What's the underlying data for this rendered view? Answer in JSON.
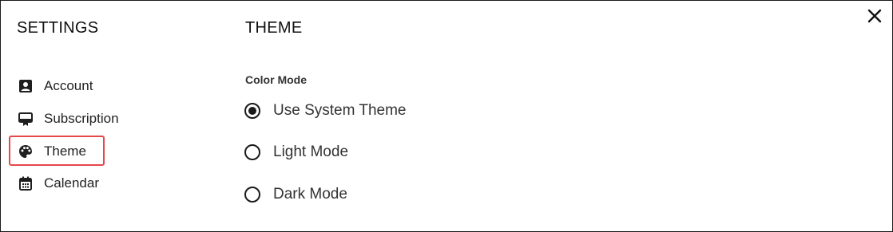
{
  "dialog": {
    "settings_title": "SETTINGS",
    "close_icon": "close-icon",
    "nav": {
      "items": [
        {
          "label": "Account",
          "icon": "account-box-icon"
        },
        {
          "label": "Subscription",
          "icon": "subscription-card-icon"
        },
        {
          "label": "Theme",
          "icon": "palette-icon",
          "selected": true
        },
        {
          "label": "Calendar",
          "icon": "calendar-icon"
        }
      ]
    },
    "highlight_color": "#e5474b"
  },
  "theme": {
    "title": "THEME",
    "color_mode_label": "Color Mode",
    "options": [
      {
        "label": "Use System Theme",
        "checked": true
      },
      {
        "label": "Light Mode",
        "checked": false
      },
      {
        "label": "Dark Mode",
        "checked": false
      }
    ]
  }
}
